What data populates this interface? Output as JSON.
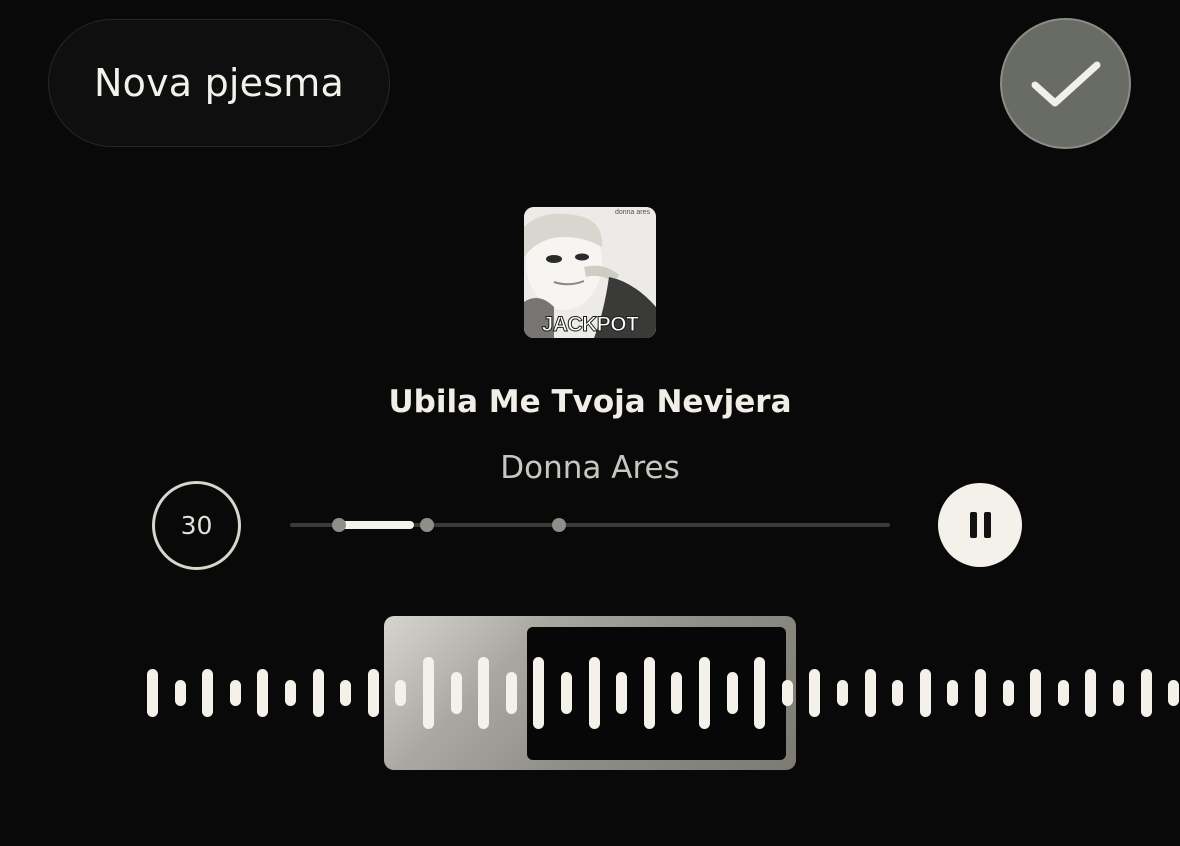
{
  "header": {
    "new_song_label": "Nova pjesma",
    "confirm_icon": "checkmark-icon"
  },
  "cover": {
    "album_title": "JACKPOT",
    "artist_small": "donna ares"
  },
  "track": {
    "title": "Ubila Me Tvoja Nevjera",
    "artist": "Donna Ares"
  },
  "player": {
    "clip_length": "30",
    "pause_icon": "pause-icon",
    "progress_fraction": 0.21
  },
  "colors": {
    "background": "#090909",
    "accent_light": "#f4f1eb",
    "confirm_bg": "#696b65"
  }
}
